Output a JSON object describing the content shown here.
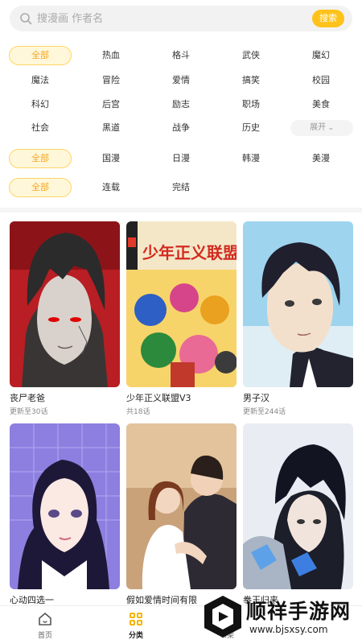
{
  "search": {
    "placeholder": "搜漫画 作者名",
    "button_label": "搜索"
  },
  "filters": {
    "genre_row1": [
      "全部",
      "热血",
      "格斗",
      "武侠",
      "魔幻"
    ],
    "genre_row2": [
      "魔法",
      "冒险",
      "爱情",
      "搞笑",
      "校园"
    ],
    "genre_row3": [
      "科幻",
      "后宫",
      "励志",
      "职场",
      "美食"
    ],
    "genre_row4": [
      "社会",
      "黑道",
      "战争",
      "历史"
    ],
    "expand_label": "展开",
    "region": [
      "全部",
      "国漫",
      "日漫",
      "韩漫",
      "美漫"
    ],
    "status": [
      "全部",
      "连载",
      "完结"
    ]
  },
  "comics": [
    {
      "title": "丧尸老爸",
      "subtitle": "更新至30话"
    },
    {
      "title": "少年正义联盟V3",
      "subtitle": "共18话",
      "cover_text": "少年正义联盟"
    },
    {
      "title": "男子汉",
      "subtitle": "更新至244话"
    },
    {
      "title": "心动四选一",
      "subtitle": ""
    },
    {
      "title": "假如爱情时间有限",
      "subtitle": ""
    },
    {
      "title": "拳王归来",
      "subtitle": ""
    }
  ],
  "tabbar": {
    "home_label": "首页",
    "category_label": "分类",
    "bookshelf_label": "书架"
  },
  "watermark": {
    "title": "顺祥手游网",
    "url": "www.bjsxsy.com"
  },
  "colors": {
    "accent": "#ffc21a",
    "chip_bg": "#fff7d9",
    "chip_text": "#f5a623"
  }
}
